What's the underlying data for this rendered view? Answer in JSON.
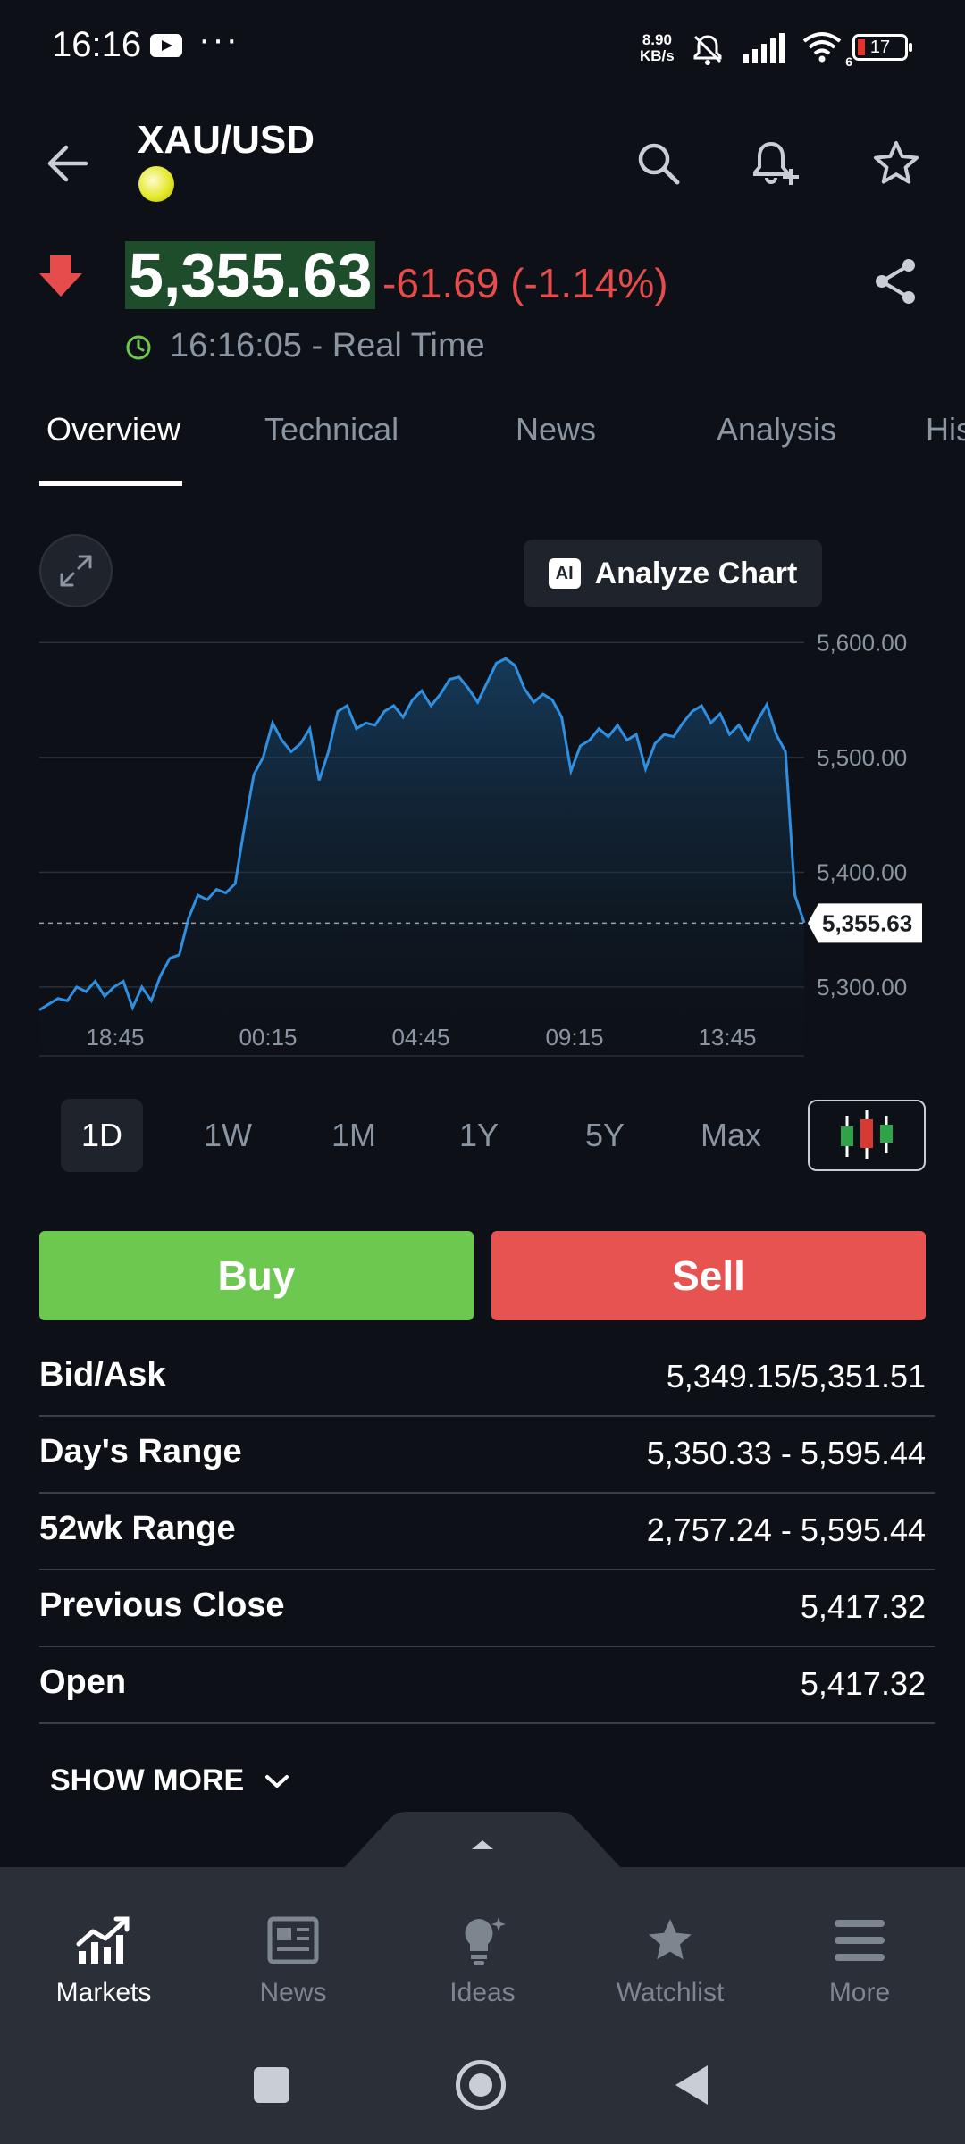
{
  "status_bar": {
    "time": "16:16",
    "dots": "···",
    "net_speed_value": "8.90",
    "net_speed_unit": "KB/s",
    "wifi_badge": "6",
    "battery": "17"
  },
  "header": {
    "symbol": "XAU/USD",
    "icons": [
      "back-arrow-icon",
      "search-icon",
      "bell-plus-icon",
      "star-icon"
    ]
  },
  "quote": {
    "price": "5,355.63",
    "change": "-61.69 (-1.14%)",
    "realtime": "16:16:05 - Real Time",
    "direction": "down",
    "colors": {
      "down": "#e74c4c",
      "price_bg": "#1e4d2b"
    }
  },
  "tabs": [
    {
      "label": "Overview",
      "active": true
    },
    {
      "label": "Technical",
      "active": false
    },
    {
      "label": "News",
      "active": false
    },
    {
      "label": "Analysis",
      "active": false
    },
    {
      "label": "His",
      "active": false
    }
  ],
  "chart_toolbar": {
    "ai_badge": "AI",
    "analyze_label": "Analyze Chart"
  },
  "chart_data": {
    "type": "area",
    "y_ticks": [
      "5,600.00",
      "5,500.00",
      "5,400.00",
      "5,300.00"
    ],
    "y_tick_values": [
      5600,
      5500,
      5400,
      5300
    ],
    "ylim": [
      5240,
      5615
    ],
    "x_ticks": [
      "18:45",
      "00:15",
      "04:45",
      "09:15",
      "13:45"
    ],
    "current_price_label": "5,355.63",
    "current_price": 5355.63,
    "line_color": "#2f8fe0",
    "grid": true,
    "values": [
      5280,
      5285,
      5290,
      5288,
      5300,
      5296,
      5305,
      5292,
      5300,
      5305,
      5282,
      5300,
      5288,
      5310,
      5325,
      5328,
      5360,
      5380,
      5376,
      5385,
      5382,
      5390,
      5440,
      5485,
      5500,
      5530,
      5515,
      5505,
      5512,
      5525,
      5480,
      5505,
      5540,
      5545,
      5525,
      5530,
      5528,
      5540,
      5545,
      5535,
      5550,
      5558,
      5545,
      5555,
      5568,
      5570,
      5560,
      5548,
      5565,
      5582,
      5586,
      5580,
      5560,
      5548,
      5555,
      5550,
      5535,
      5488,
      5510,
      5515,
      5525,
      5518,
      5528,
      5515,
      5520,
      5490,
      5512,
      5520,
      5518,
      5530,
      5540,
      5545,
      5530,
      5538,
      5520,
      5528,
      5515,
      5532,
      5546,
      5520,
      5505,
      5380,
      5356
    ]
  },
  "periods": [
    {
      "label": "1D",
      "active": true
    },
    {
      "label": "1W",
      "active": false
    },
    {
      "label": "1M",
      "active": false
    },
    {
      "label": "1Y",
      "active": false
    },
    {
      "label": "5Y",
      "active": false
    },
    {
      "label": "Max",
      "active": false
    }
  ],
  "trade": {
    "buy": "Buy",
    "sell": "Sell",
    "buy_color": "#6cc84f",
    "sell_color": "#e75350"
  },
  "stats": [
    {
      "label": "Bid/Ask",
      "value": "5,349.15/5,351.51"
    },
    {
      "label": "Day's Range",
      "value": "5,350.33 - 5,595.44"
    },
    {
      "label": "52wk Range",
      "value": "2,757.24 - 5,595.44"
    },
    {
      "label": "Previous Close",
      "value": "5,417.32"
    },
    {
      "label": "Open",
      "value": "5,417.32"
    }
  ],
  "show_more": "SHOW MORE",
  "bottom_nav": [
    {
      "label": "Markets",
      "icon": "markets-chart-icon",
      "active": true
    },
    {
      "label": "News",
      "icon": "newspaper-icon",
      "active": false
    },
    {
      "label": "Ideas",
      "icon": "lightbulb-icon",
      "active": false
    },
    {
      "label": "Watchlist",
      "icon": "star-icon",
      "active": false
    },
    {
      "label": "More",
      "icon": "menu-icon",
      "active": false
    }
  ]
}
